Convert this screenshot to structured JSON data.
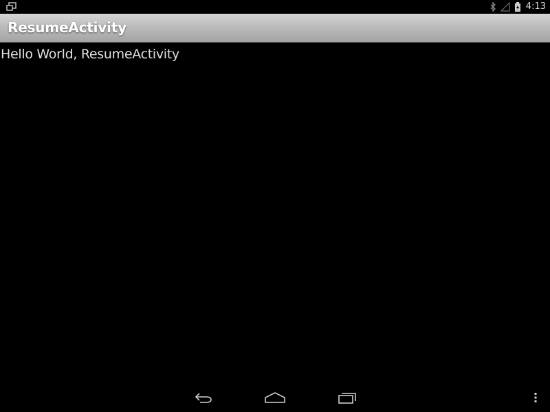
{
  "status_bar": {
    "time": "4:13",
    "icons": [
      "notification-window-icon",
      "bluetooth-icon",
      "signal-icon",
      "battery-icon"
    ]
  },
  "action_bar": {
    "title": "ResumeActivity",
    "gradient_top": "#d6d6d6",
    "gradient_bottom": "#a4a4a4"
  },
  "content": {
    "text": "Hello World, ResumeActivity"
  },
  "nav_bar": {
    "buttons": [
      "back-icon",
      "home-icon",
      "recents-icon",
      "overflow-menu-icon"
    ]
  },
  "colors": {
    "background": "#000000",
    "text": "#e0e0e0",
    "title_text": "#ffffff"
  }
}
